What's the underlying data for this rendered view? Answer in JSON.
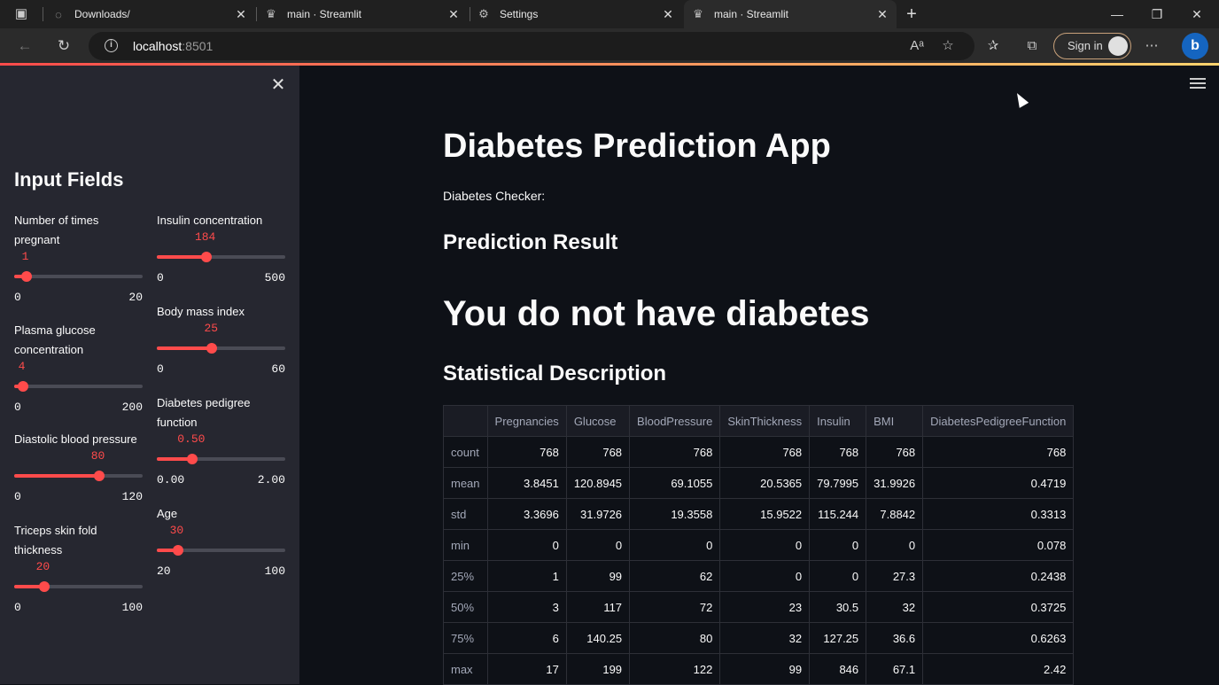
{
  "browser": {
    "tabs": [
      {
        "title": "Downloads/"
      },
      {
        "title": "main · Streamlit"
      },
      {
        "title": "Settings"
      },
      {
        "title": "main · Streamlit"
      }
    ],
    "url_host": "localhost",
    "url_port": ":8501",
    "signin_label": "Sign in"
  },
  "sidebar": {
    "title": "Input Fields",
    "left_fields": [
      {
        "label_line1": "Number of times",
        "label_line2": "pregnant",
        "value": "1",
        "min": "0",
        "max": "20",
        "fraction": 0.05
      },
      {
        "label_line1": "Plasma glucose",
        "label_line2": "concentration",
        "value": "4",
        "min": "0",
        "max": "200",
        "fraction": 0.02
      },
      {
        "label_line1": "Diastolic blood pressure",
        "label_line2": "",
        "value": "80",
        "min": "0",
        "max": "120",
        "fraction": 0.667
      },
      {
        "label_line1": "Triceps skin fold",
        "label_line2": "thickness",
        "value": "20",
        "min": "0",
        "max": "100",
        "fraction": 0.2
      }
    ],
    "right_fields": [
      {
        "label_line1": "Insulin concentration",
        "label_line2": "",
        "value": "184",
        "min": "0",
        "max": "500",
        "fraction": 0.368
      },
      {
        "label_line1": "Body mass index",
        "label_line2": "",
        "value": "25",
        "min": "0",
        "max": "60",
        "fraction": 0.417
      },
      {
        "label_line1": "Diabetes pedigree",
        "label_line2": "function",
        "value": "0.50",
        "min": "0.00",
        "max": "2.00",
        "fraction": 0.25
      },
      {
        "label_line1": "Age",
        "label_line2": "",
        "value": "30",
        "min": "20",
        "max": "100",
        "fraction": 0.125
      }
    ]
  },
  "main": {
    "title": "Diabetes Prediction App",
    "subtitle": "Diabetes Checker:",
    "result_heading": "Prediction Result",
    "result_text": "You do not have diabetes",
    "stats_heading": "Statistical Description"
  },
  "table": {
    "columns": [
      "",
      "Pregnancies",
      "Glucose",
      "BloodPressure",
      "SkinThickness",
      "Insulin",
      "BMI",
      "DiabetesPedigreeFunction"
    ],
    "rows": [
      [
        "count",
        "768",
        "768",
        "768",
        "768",
        "768",
        "768",
        "768"
      ],
      [
        "mean",
        "3.8451",
        "120.8945",
        "69.1055",
        "20.5365",
        "79.7995",
        "31.9926",
        "0.4719"
      ],
      [
        "std",
        "3.3696",
        "31.9726",
        "19.3558",
        "15.9522",
        "115.244",
        "7.8842",
        "0.3313"
      ],
      [
        "min",
        "0",
        "0",
        "0",
        "0",
        "0",
        "0",
        "0.078"
      ],
      [
        "25%",
        "1",
        "99",
        "62",
        "0",
        "0",
        "27.3",
        "0.2438"
      ],
      [
        "50%",
        "3",
        "117",
        "72",
        "23",
        "30.5",
        "32",
        "0.3725"
      ],
      [
        "75%",
        "6",
        "140.25",
        "80",
        "32",
        "127.25",
        "36.6",
        "0.6263"
      ],
      [
        "max",
        "17",
        "199",
        "122",
        "99",
        "846",
        "67.1",
        "2.42"
      ]
    ]
  },
  "colors": {
    "accent": "#ff4b4b",
    "sidebar_bg": "#262730",
    "main_bg": "#0e1117"
  }
}
